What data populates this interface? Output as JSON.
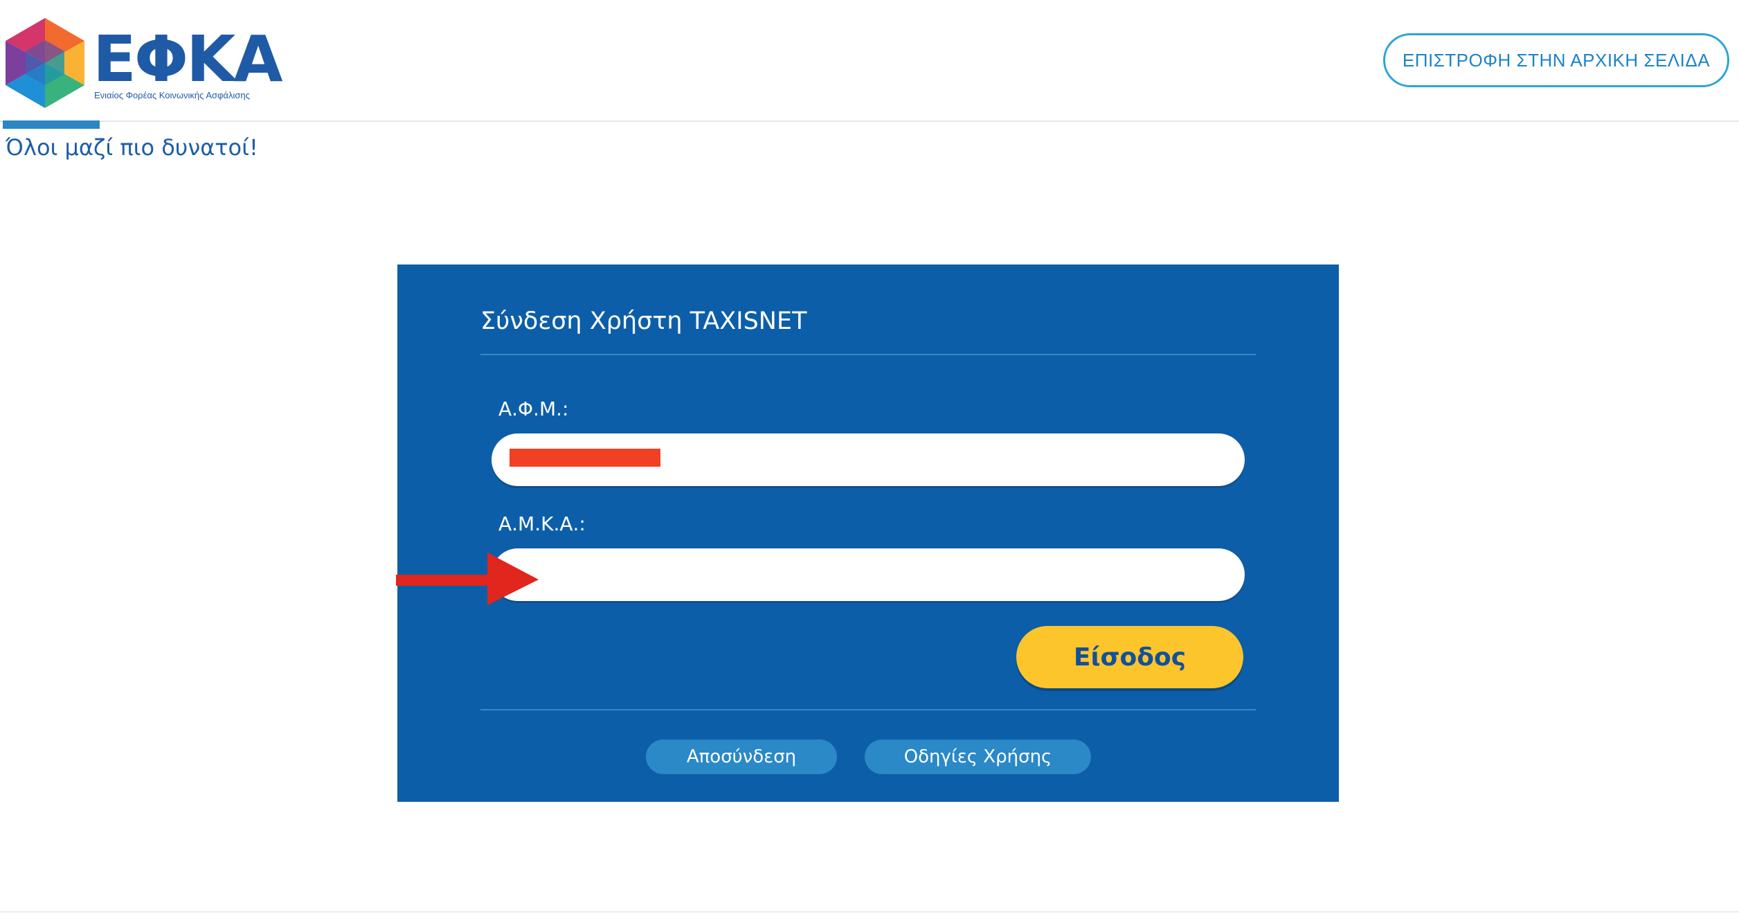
{
  "header": {
    "logo_text": "ΕΦΚΑ",
    "logo_subtitle": "Ενιαίος Φορέας Κοινωνικής Ασφάλισης",
    "home_button_label": "ΕΠΙΣΤΡΟΦΗ ΣΤΗΝ ΑΡΧΙΚΗ ΣΕΛΙΔΑ",
    "tagline": "Όλοι μαζί πιο δυνατοί!"
  },
  "login": {
    "title": "Σύνδεση Χρήστη TAXISNET",
    "afm_label": "Α.Φ.Μ.:",
    "afm_value": "",
    "afm_redacted": true,
    "amka_label": "Α.Μ.Κ.Α.:",
    "amka_value": "",
    "submit_label": "Είσοδος",
    "logout_label": "Αποσύνδεση",
    "help_label": "Οδηγίες Χρήσης"
  },
  "annotation": {
    "arrow_icon": "red-arrow-right-icon",
    "target": "amka-input"
  },
  "colors": {
    "panel_background": "#0d5ea8",
    "brand_blue": "#1f5aa6",
    "accent_cyan": "#2aa4dc",
    "login_button": "#fcc52c",
    "pill_button": "#2a89c6",
    "redaction": "#f24025",
    "arrow": "#e0261d"
  }
}
